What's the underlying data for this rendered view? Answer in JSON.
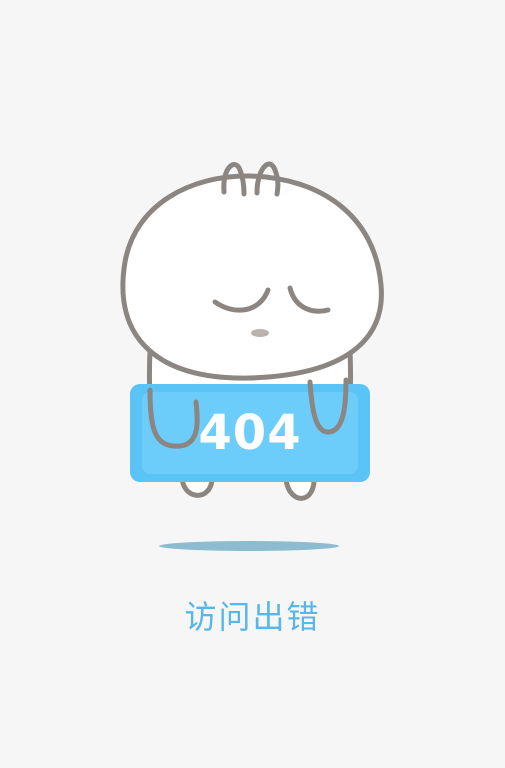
{
  "error": {
    "code": "404",
    "message": "访问出错"
  },
  "colors": {
    "background": "#f6f6f6",
    "sign": "#5bc4f7",
    "sign_inner": "#6ccdfb",
    "outline": "#8c8683",
    "message": "#5ab6e6",
    "shadow": "#8dbcd0"
  },
  "illustration": {
    "name": "bun-character-holding-404-sign"
  }
}
